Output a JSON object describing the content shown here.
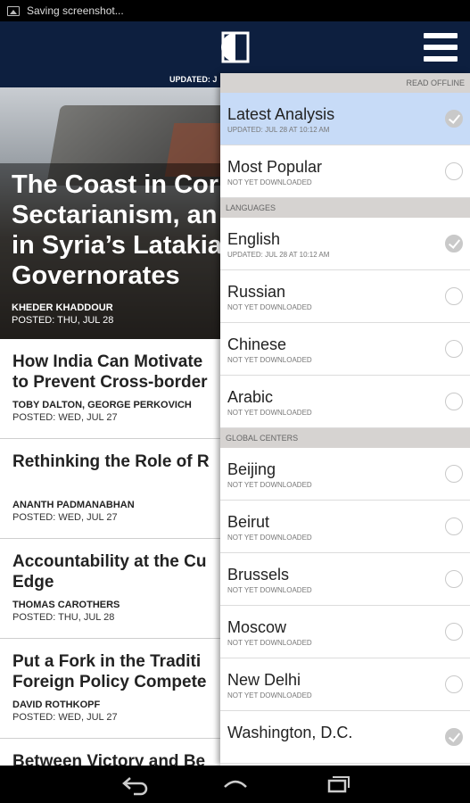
{
  "status_bar": {
    "notification": "Saving screenshot..."
  },
  "header": {
    "updated": "UPDATED: J"
  },
  "hero": {
    "title_lines": [
      "The Coast in Cor",
      "Sectarianism, an",
      "in Syria’s Latakia",
      "Governorates"
    ],
    "author": "KHEDER KHADDOUR",
    "posted": "POSTED: THU, JUL 28"
  },
  "articles": [
    {
      "title_lines": [
        "How India Can Motivate",
        "to Prevent Cross-border"
      ],
      "author": "TOBY DALTON, GEORGE PERKOVICH",
      "posted": "POSTED: WED, JUL 27"
    },
    {
      "title_lines": [
        "Rethinking the Role of R"
      ],
      "author": "ANANTH PADMANABHAN",
      "posted": "POSTED: WED, JUL 27"
    },
    {
      "title_lines": [
        "Accountability at the Cu",
        "Edge"
      ],
      "author": "THOMAS CAROTHERS",
      "posted": "POSTED: THU, JUL 28"
    },
    {
      "title_lines": [
        "Put a Fork in the Traditi",
        "Foreign Policy Compete"
      ],
      "author": "DAVID ROTHKOPF",
      "posted": "POSTED: WED, JUL 27"
    },
    {
      "title_lines": [
        "Between Victory and Be"
      ],
      "author": "",
      "posted": ""
    }
  ],
  "drawer": {
    "read_offline_label": "READ OFFLINE",
    "feeds": [
      {
        "label": "Latest Analysis",
        "sub": "UPDATED: JUL 28 AT 10:12 AM",
        "checked": true,
        "active": true
      },
      {
        "label": "Most Popular",
        "sub": "NOT YET DOWNLOADED",
        "checked": false,
        "active": false
      }
    ],
    "languages_label": "LANGUAGES",
    "languages": [
      {
        "label": "English",
        "sub": "UPDATED: JUL 28 AT 10:12 AM",
        "checked": true
      },
      {
        "label": "Russian",
        "sub": "NOT YET DOWNLOADED",
        "checked": false
      },
      {
        "label": "Chinese",
        "sub": "NOT YET DOWNLOADED",
        "checked": false
      },
      {
        "label": "Arabic",
        "sub": "NOT YET DOWNLOADED",
        "checked": false
      }
    ],
    "centers_label": "GLOBAL CENTERS",
    "centers": [
      {
        "label": "Beijing",
        "sub": "NOT YET DOWNLOADED",
        "checked": false
      },
      {
        "label": "Beirut",
        "sub": "NOT YET DOWNLOADED",
        "checked": false
      },
      {
        "label": "Brussels",
        "sub": "NOT YET DOWNLOADED",
        "checked": false
      },
      {
        "label": "Moscow",
        "sub": "NOT YET DOWNLOADED",
        "checked": false
      },
      {
        "label": "New Delhi",
        "sub": "NOT YET DOWNLOADED",
        "checked": false
      },
      {
        "label": "Washington, D.C.",
        "sub": "",
        "checked": true
      }
    ]
  },
  "colors": {
    "header_bg": "#0d1f3f",
    "active_row": "#c7dbf7",
    "section_head": "#d6d3d1"
  }
}
